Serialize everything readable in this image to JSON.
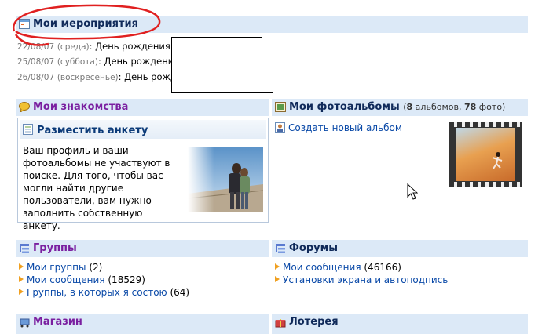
{
  "events": {
    "title": "Мои мероприятия",
    "items": [
      {
        "date": "22/08/07",
        "day": "(среда)",
        "text": ": День рождения: "
      },
      {
        "date": "25/08/07",
        "day": "(суббота)",
        "text": ": День рождения: "
      },
      {
        "date": "26/08/07",
        "day": "(воскресенье)",
        "text": ": День рожде"
      }
    ]
  },
  "acquaintances": {
    "title": "Мои знакомства",
    "card_title": "Разместить анкету",
    "card_text": "Ваш профиль и ваши фотоальбомы не участвуют в поиске. Для того, чтобы вас могли найти другие пользователи, вам нужно заполнить собственную анкету."
  },
  "albums": {
    "title": "Мои фотоальбомы",
    "count_open": "(",
    "albums_count": "8",
    "albums_word": " альбомов, ",
    "photos_count": "78",
    "photos_word": " фото)",
    "create_link": "Создать новый альбом"
  },
  "groups": {
    "title": "Группы",
    "items": [
      {
        "label": "Мои группы",
        "count": "(2)"
      },
      {
        "label": "Мои сообщения",
        "count": "(18529)"
      },
      {
        "label": "Группы, в которых я состою",
        "count": "(64)"
      }
    ]
  },
  "forums": {
    "title": "Форумы",
    "items": [
      {
        "label": "Мои сообщения",
        "count": "(46166)"
      },
      {
        "label": "Установки экрана и автоподпись",
        "count": ""
      }
    ]
  },
  "shop": {
    "title": "Магазин"
  },
  "lottery": {
    "title": "Лотерея"
  },
  "colors": {
    "header_bg": "#dce9f7",
    "purple": "#7a1fa0",
    "link": "#0b4aa8",
    "annotation": "#e02020"
  }
}
